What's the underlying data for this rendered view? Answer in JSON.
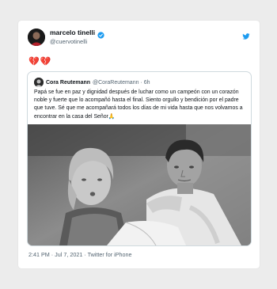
{
  "tweet": {
    "author_name": "marcelo tinelli",
    "author_handle": "@cuervotinelli",
    "body": "💔💔",
    "timestamp": "2:41 PM · Jul 7, 2021",
    "source": "Twitter for iPhone",
    "footer": "2:41 PM · Jul 7, 2021 · Twitter for iPhone"
  },
  "quoted": {
    "author_name": "Cora Reutemann",
    "author_handle": "@CoraReutemann",
    "age": "6h",
    "meta": "@CoraReutemann · 6h",
    "text": "Papá se fue en paz y dignidad después de luchar como un campeón con un corazón noble y fuerte que lo acompañó hasta el final. Siento orgullo y bendición por el padre que tuve. Sé que me acompañará todos los días de mi vida hasta que nos volvamos a encontrar en la casa del Señor🙏"
  },
  "icons": {
    "verified": "verified-badge-icon",
    "twitter": "twitter-bird-icon"
  },
  "colors": {
    "verified": "#1d9bf0",
    "twitter": "#1d9bf0",
    "heart": "#dd2e44",
    "secondary_text": "#536471"
  }
}
